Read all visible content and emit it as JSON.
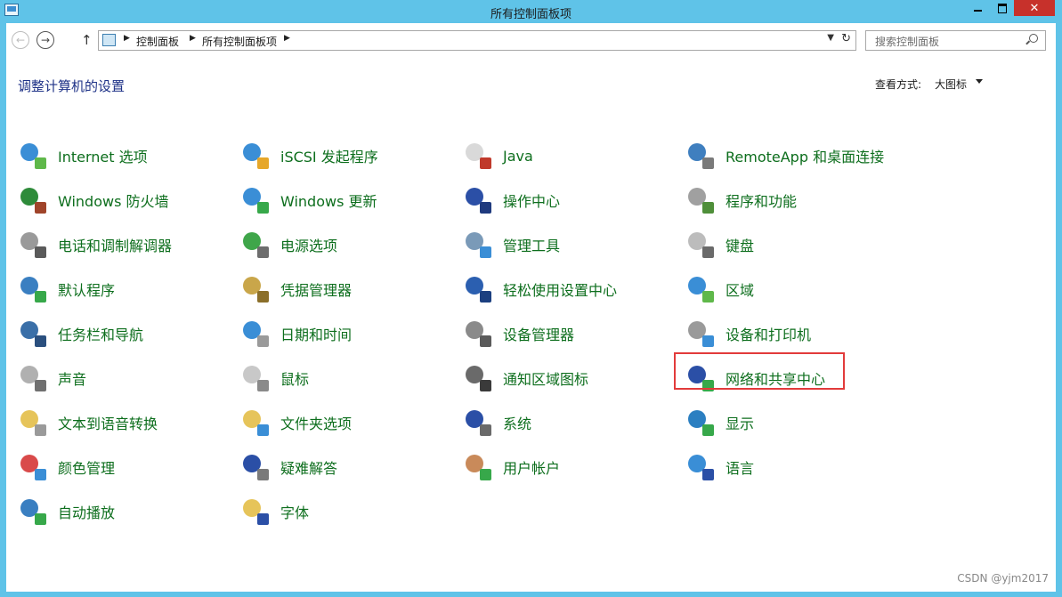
{
  "window": {
    "title": "所有控制面板项"
  },
  "controls": {
    "minimize": "—",
    "maximize": "□",
    "close": "✕"
  },
  "nav": {
    "back": "←",
    "forward": "→",
    "up": "↑",
    "breadcrumb": [
      "控制面板",
      "所有控制面板项"
    ],
    "search_placeholder": "搜索控制面板"
  },
  "page": {
    "heading": "调整计算机的设置",
    "view_by_label": "查看方式:",
    "view_by_value": "大图标"
  },
  "items": [
    {
      "label": "Internet 选项",
      "icon": "internet-options-icon",
      "c1": "#3a8ed6",
      "c2": "#5fb84a"
    },
    {
      "label": "iSCSI 发起程序",
      "icon": "iscsi-initiator-icon",
      "c1": "#3a8ed6",
      "c2": "#e6a72a"
    },
    {
      "label": "Java",
      "icon": "java-icon",
      "c1": "#d9d9d9",
      "c2": "#c0392b"
    },
    {
      "label": "RemoteApp 和桌面连接",
      "icon": "remoteapp-icon",
      "c1": "#3f7fbf",
      "c2": "#7a7a7a"
    },
    {
      "label": "Windows 防火墙",
      "icon": "firewall-icon",
      "c1": "#2e8b3a",
      "c2": "#a0442a"
    },
    {
      "label": "Windows 更新",
      "icon": "windows-update-icon",
      "c1": "#3a8ed6",
      "c2": "#37a84a"
    },
    {
      "label": "操作中心",
      "icon": "action-center-icon",
      "c1": "#2b4fa6",
      "c2": "#1f3a7e"
    },
    {
      "label": "程序和功能",
      "icon": "programs-features-icon",
      "c1": "#a0a0a0",
      "c2": "#4f8f3a"
    },
    {
      "label": "电话和调制解调器",
      "icon": "phone-modem-icon",
      "c1": "#9a9a9a",
      "c2": "#5a5a5a"
    },
    {
      "label": "电源选项",
      "icon": "power-options-icon",
      "c1": "#3fa64a",
      "c2": "#6d6d6d"
    },
    {
      "label": "管理工具",
      "icon": "admin-tools-icon",
      "c1": "#7a9ab8",
      "c2": "#3a8ed6"
    },
    {
      "label": "键盘",
      "icon": "keyboard-icon",
      "c1": "#bcbcbc",
      "c2": "#6a6a6a"
    },
    {
      "label": "默认程序",
      "icon": "default-programs-icon",
      "c1": "#3a7fc1",
      "c2": "#37a84a"
    },
    {
      "label": "凭据管理器",
      "icon": "credential-manager-icon",
      "c1": "#c9a64a",
      "c2": "#8b6f2a"
    },
    {
      "label": "轻松使用设置中心",
      "icon": "ease-of-access-icon",
      "c1": "#2b5fb0",
      "c2": "#1b3f80"
    },
    {
      "label": "区域",
      "icon": "region-icon",
      "c1": "#3a8ed6",
      "c2": "#5fb84a"
    },
    {
      "label": "任务栏和导航",
      "icon": "taskbar-icon",
      "c1": "#3a6fa8",
      "c2": "#2a4f7e"
    },
    {
      "label": "日期和时间",
      "icon": "date-time-icon",
      "c1": "#3a8ed6",
      "c2": "#9a9a9a"
    },
    {
      "label": "设备管理器",
      "icon": "device-manager-icon",
      "c1": "#8a8a8a",
      "c2": "#5a5a5a"
    },
    {
      "label": "设备和打印机",
      "icon": "devices-printers-icon",
      "c1": "#9a9a9a",
      "c2": "#3a8ed6"
    },
    {
      "label": "声音",
      "icon": "sound-icon",
      "c1": "#b0b0b0",
      "c2": "#707070"
    },
    {
      "label": "鼠标",
      "icon": "mouse-icon",
      "c1": "#c8c8c8",
      "c2": "#8a8a8a"
    },
    {
      "label": "通知区域图标",
      "icon": "notification-area-icon",
      "c1": "#6a6a6a",
      "c2": "#3a3a3a"
    },
    {
      "label": "网络和共享中心",
      "icon": "network-sharing-icon",
      "c1": "#2b4fa6",
      "c2": "#37a84a",
      "highlight": true
    },
    {
      "label": "文本到语音转换",
      "icon": "text-to-speech-icon",
      "c1": "#e6c45a",
      "c2": "#9a9a9a"
    },
    {
      "label": "文件夹选项",
      "icon": "folder-options-icon",
      "c1": "#e6c45a",
      "c2": "#3a8ed6"
    },
    {
      "label": "系统",
      "icon": "system-icon",
      "c1": "#2b4fa6",
      "c2": "#6a6a6a"
    },
    {
      "label": "显示",
      "icon": "display-icon",
      "c1": "#2b7fc1",
      "c2": "#37a84a"
    },
    {
      "label": "颜色管理",
      "icon": "color-management-icon",
      "c1": "#d94a4a",
      "c2": "#3a8ed6"
    },
    {
      "label": "疑难解答",
      "icon": "troubleshooting-icon",
      "c1": "#2b4fa6",
      "c2": "#7a7a7a"
    },
    {
      "label": "用户帐户",
      "icon": "user-accounts-icon",
      "c1": "#c98a5a",
      "c2": "#37a84a"
    },
    {
      "label": "语言",
      "icon": "language-icon",
      "c1": "#3a8ed6",
      "c2": "#2b4fa6"
    },
    {
      "label": "自动播放",
      "icon": "autoplay-icon",
      "c1": "#3a7fc1",
      "c2": "#37a84a"
    },
    {
      "label": "字体",
      "icon": "fonts-icon",
      "c1": "#e6c45a",
      "c2": "#2b4fa6"
    }
  ],
  "watermark": "CSDN @yjm2017"
}
